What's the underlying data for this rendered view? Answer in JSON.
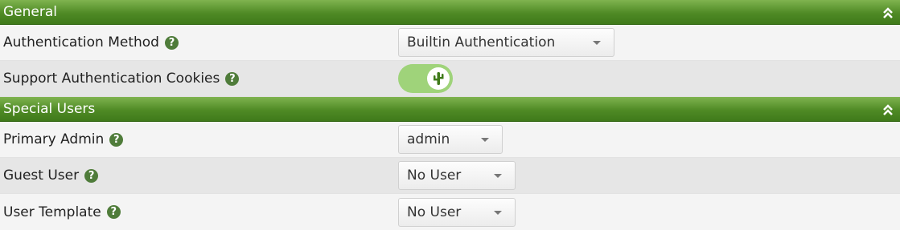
{
  "sections": {
    "general": {
      "title": "General",
      "auth_method": {
        "label": "Authentication Method",
        "value": "Builtin Authentication"
      },
      "auth_cookies": {
        "label": "Support Authentication Cookies",
        "enabled": true
      }
    },
    "special_users": {
      "title": "Special Users",
      "primary_admin": {
        "label": "Primary Admin",
        "value": "admin"
      },
      "guest_user": {
        "label": "Guest User",
        "value": "No User"
      },
      "user_template": {
        "label": "User Template",
        "value": "No User"
      }
    }
  },
  "icons": {
    "help": "help-question-icon",
    "collapse": "double-chevron-up-icon",
    "toggle_knob": "cactus-icon"
  },
  "colors": {
    "header_green": "#4f8a25",
    "toggle_on": "#9fd37a",
    "help_icon": "#4f7c3a"
  }
}
